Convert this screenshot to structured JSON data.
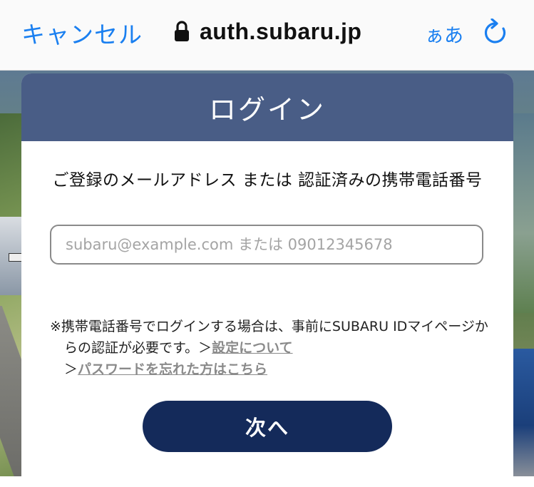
{
  "browser": {
    "cancel_label": "キャンセル",
    "url": "auth.subaru.jp",
    "text_size_label": "ぁあ",
    "lock_icon": "lock-icon",
    "reload_icon": "reload-icon"
  },
  "login": {
    "title": "ログイン",
    "field_label": "ご登録のメールアドレス または 認証済みの携帯電話番号",
    "input_placeholder": "subaru@example.com または 09012345678",
    "input_value": "",
    "note_text": "※携帯電話番号でログインする場合は、事前にSUBARU IDマイページからの認証が必要です。",
    "arrow": "＞",
    "settings_link": "設定について",
    "forgot_link": "パスワードを忘れた方はこちら",
    "next_label": "次へ"
  },
  "colors": {
    "accent": "#1a7ff0",
    "header_bg": "#163064",
    "button_bg": "#142a5a"
  }
}
